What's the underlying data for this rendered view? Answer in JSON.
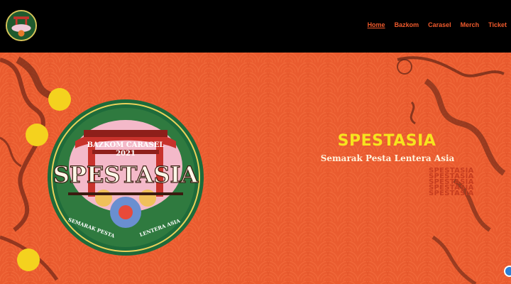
{
  "header": {
    "logo_icon": "spestasia-logo",
    "nav": [
      {
        "label": "Home",
        "active": true
      },
      {
        "label": "Bazkom",
        "active": false
      },
      {
        "label": "Carasel",
        "active": false
      },
      {
        "label": "Merch",
        "active": false
      },
      {
        "label": "Ticket",
        "active": false
      }
    ]
  },
  "hero": {
    "title": "SPESTASIA",
    "subtitle": "Semarak Pesta Lentera Asia",
    "echo_text": [
      "SPESTASIA",
      "SPESTASIA",
      "SPESTASIA",
      "SPESTASIA",
      "SPESTASIA"
    ],
    "badge": {
      "top_text": "BAZKOM CARASEL",
      "year": "2021",
      "name": "SPESTASIA",
      "left_text": "SEMARAK PESTA",
      "right_text": "LENTERA ASIA"
    }
  },
  "colors": {
    "background": "#ea5b2f",
    "nav_accent": "#ef5a2c",
    "title": "#f7e31e",
    "dots": "#f4d21e"
  }
}
